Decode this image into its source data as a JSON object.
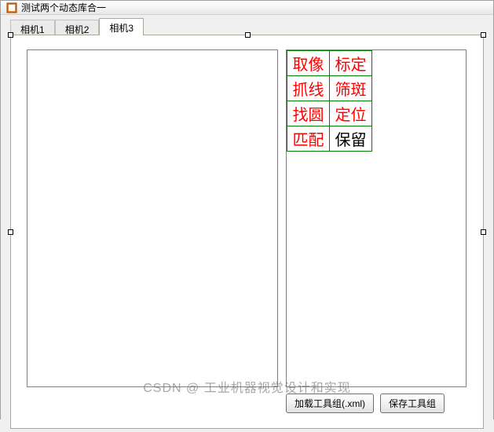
{
  "window": {
    "title": "测试两个动态库合一"
  },
  "tabs": {
    "items": [
      {
        "label": "相机1"
      },
      {
        "label": "相机2"
      },
      {
        "label": "相机3"
      }
    ],
    "active_index": 2
  },
  "tool_grid": {
    "rows": [
      [
        {
          "label": "取像",
          "style": "red"
        },
        {
          "label": "标定",
          "style": "red"
        }
      ],
      [
        {
          "label": "抓线",
          "style": "red"
        },
        {
          "label": "筛斑",
          "style": "red"
        }
      ],
      [
        {
          "label": "找圆",
          "style": "red"
        },
        {
          "label": "定位",
          "style": "red"
        }
      ],
      [
        {
          "label": "匹配",
          "style": "red"
        },
        {
          "label": "保留",
          "style": "black"
        }
      ]
    ]
  },
  "buttons": {
    "load_label": "加载工具组(.xml)",
    "save_label": "保存工具组"
  },
  "watermark": "CSDN @ 工业机器视觉设计和实现"
}
